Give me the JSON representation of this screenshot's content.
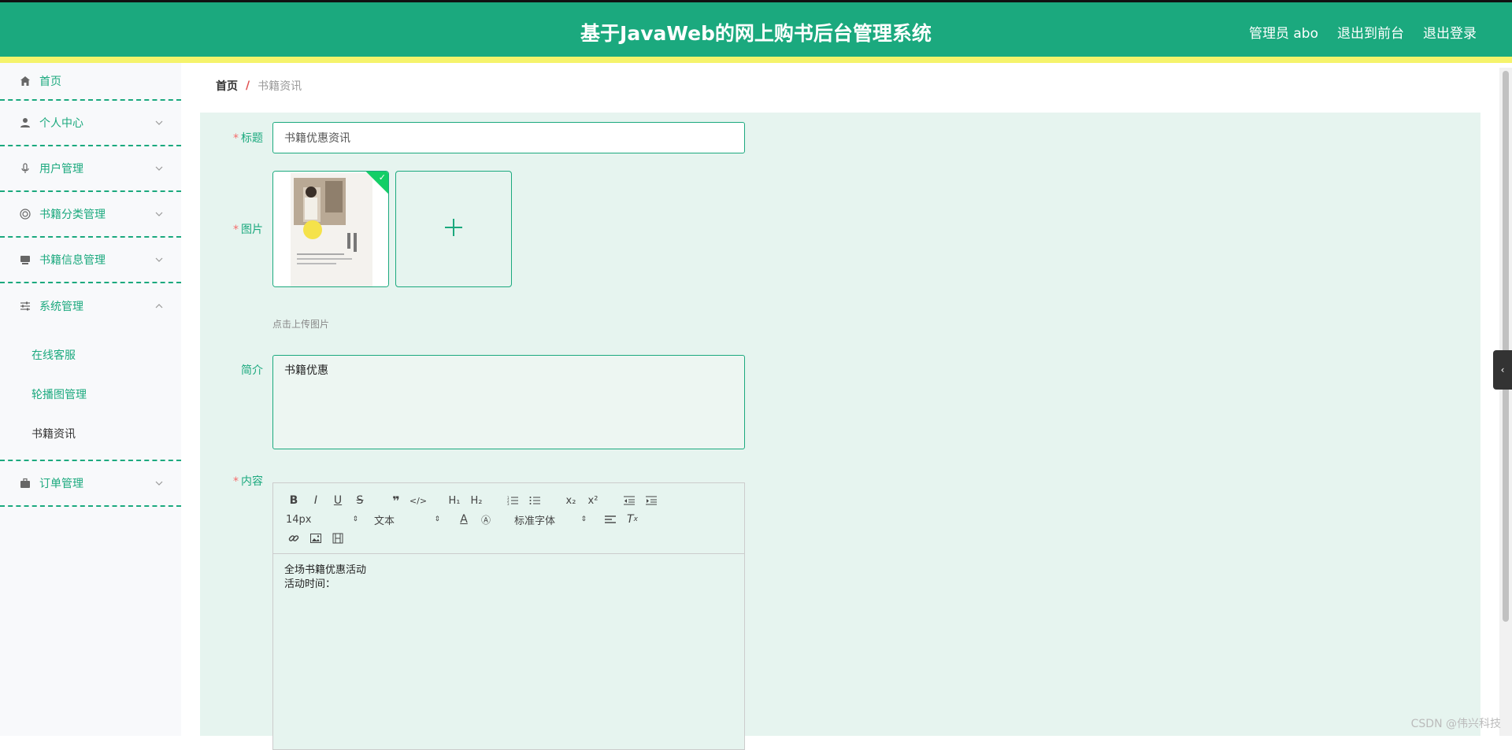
{
  "header": {
    "title": "基于JavaWeb的网上购书后台管理系统",
    "admin": "管理员 abo",
    "to_front": "退出到前台",
    "logout": "退出登录"
  },
  "sidebar": {
    "items": [
      {
        "label": "首页",
        "icon": "home-icon"
      },
      {
        "label": "个人中心",
        "icon": "user-icon"
      },
      {
        "label": "用户管理",
        "icon": "mic-icon"
      },
      {
        "label": "书籍分类管理",
        "icon": "lifebuoy-icon"
      },
      {
        "label": "书籍信息管理",
        "icon": "monitor-icon"
      },
      {
        "label": "系统管理",
        "icon": "sliders-icon"
      },
      {
        "label": "订单管理",
        "icon": "briefcase-icon"
      }
    ],
    "system_submenu": [
      "在线客服",
      "轮播图管理",
      "书籍资讯"
    ]
  },
  "breadcrumb": {
    "home": "首页",
    "separator": "/",
    "current": "书籍资讯"
  },
  "form": {
    "title_label": "标题",
    "title_value": "书籍优惠资讯",
    "image_label": "图片",
    "upload_hint": "点击上传图片",
    "intro_label": "简介",
    "intro_value": "书籍优惠",
    "content_label": "内容",
    "editor": {
      "font_size": "14px",
      "text_type": "文本",
      "font_family": "标准字体",
      "body_lines": [
        "全场书籍优惠活动",
        "活动时间："
      ]
    }
  },
  "watermark": "CSDN @伟兴科技",
  "colors": {
    "primary": "#1ba97e",
    "accent_stripe": "#f5f36b",
    "required": "#f56c6c"
  }
}
